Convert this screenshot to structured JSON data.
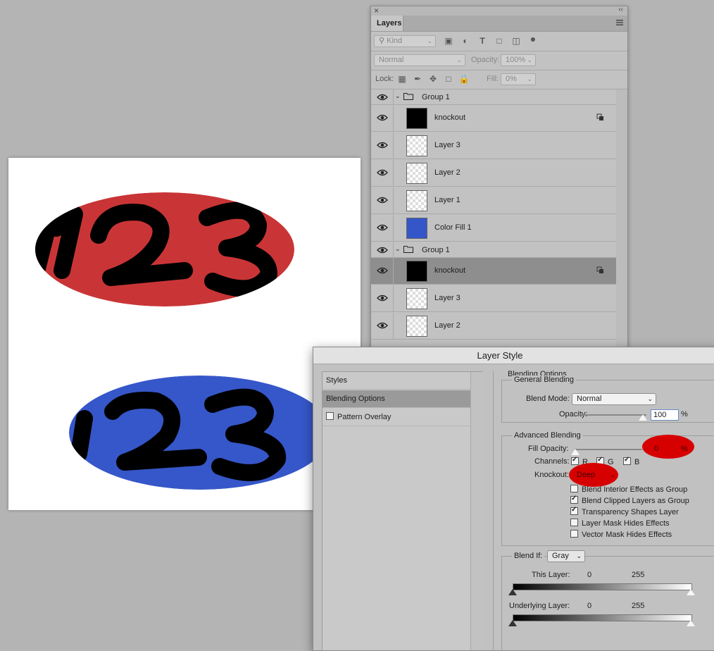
{
  "canvas": {
    "ovals": [
      {
        "color": "#c93536",
        "digits": "123"
      },
      {
        "color": "#3657c9",
        "digits": "123"
      }
    ]
  },
  "layers_panel": {
    "close_glyph": "×",
    "collapse_glyph": "‹‹",
    "tab_label": "Layers",
    "filter_kind": "Kind",
    "blend_mode": "Normal",
    "opacity_label": "Opacity:",
    "opacity_value": "100%",
    "lock_label": "Lock:",
    "fill_label": "Fill:",
    "fill_value": "0%",
    "rows": [
      {
        "type": "group",
        "name": "Group 1"
      },
      {
        "type": "layer",
        "name": "knockout",
        "thumb": "black",
        "selected": false,
        "linked": true
      },
      {
        "type": "layer",
        "name": "Layer 3",
        "thumb": "checker"
      },
      {
        "type": "layer",
        "name": "Layer 2",
        "thumb": "checker"
      },
      {
        "type": "layer",
        "name": "Layer 1",
        "thumb": "checker"
      },
      {
        "type": "layer",
        "name": "Color Fill 1",
        "thumb": "blue"
      },
      {
        "type": "group",
        "name": "Group 1"
      },
      {
        "type": "layer",
        "name": "knockout",
        "thumb": "black",
        "selected": true,
        "linked": true
      },
      {
        "type": "layer",
        "name": "Layer 3",
        "thumb": "checker"
      },
      {
        "type": "layer",
        "name": "Layer 2",
        "thumb": "checker"
      }
    ]
  },
  "dialog": {
    "title": "Layer Style",
    "left_items": [
      "Styles",
      "Blending Options",
      "Pattern Overlay"
    ],
    "blending_options_title": "Blending Options",
    "general_blending": {
      "legend": "General Blending",
      "blend_mode_label": "Blend Mode:",
      "blend_mode_value": "Normal",
      "opacity_label": "Opacity:",
      "opacity_value": "100",
      "percent": "%"
    },
    "advanced_blending": {
      "legend": "Advanced Blending",
      "fill_opacity_label": "Fill Opacity:",
      "fill_opacity_value": "0",
      "percent": "%",
      "channels_label": "Channels:",
      "channels": [
        "R",
        "G",
        "B"
      ],
      "knockout_label": "Knockout:",
      "knockout_value": "Deep",
      "options": [
        {
          "label": "Blend Interior Effects as Group",
          "checked": false
        },
        {
          "label": "Blend Clipped Layers as Group",
          "checked": true
        },
        {
          "label": "Transparency Shapes Layer",
          "checked": true
        },
        {
          "label": "Layer Mask Hides Effects",
          "checked": false
        },
        {
          "label": "Vector Mask Hides Effects",
          "checked": false
        }
      ]
    },
    "blend_if": {
      "label": "Blend If:",
      "value": "Gray",
      "this_layer_label": "This Layer:",
      "underlying_label": "Underlying Layer:",
      "min": "0",
      "max": "255"
    }
  },
  "colors": {
    "highlight_red": "#d70000",
    "selection_gray": "#8e8e8e"
  }
}
